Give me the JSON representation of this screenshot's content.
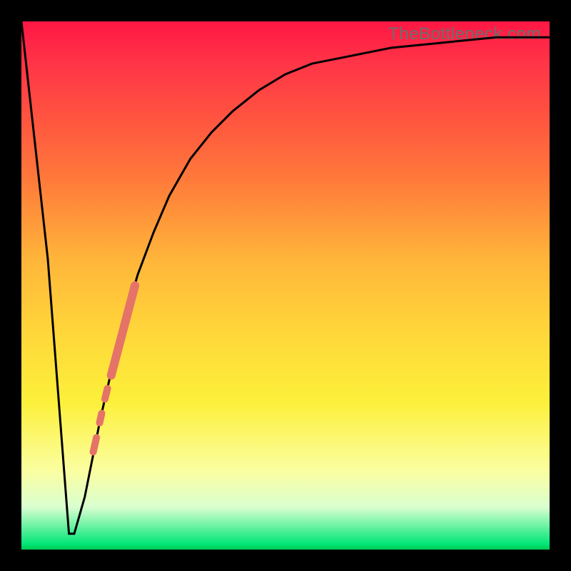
{
  "watermark": "TheBottleneck.com",
  "chart_data": {
    "type": "line",
    "title": "",
    "xlabel": "",
    "ylabel": "",
    "xlim": [
      0,
      100
    ],
    "ylim": [
      0,
      100
    ],
    "grid": false,
    "series": [
      {
        "name": "bottleneck-curve",
        "x": [
          0,
          5,
          9,
          10,
          12,
          15,
          18,
          20,
          22,
          25,
          28,
          32,
          36,
          40,
          45,
          50,
          55,
          60,
          70,
          80,
          90,
          100
        ],
        "y": [
          100,
          55,
          3,
          3,
          10,
          25,
          38,
          45,
          52,
          60,
          67,
          74,
          79,
          83,
          87,
          90,
          92,
          93,
          95,
          96,
          97,
          97
        ]
      }
    ],
    "overlay_segments": [
      {
        "name": "highlight-thick",
        "x0": 17.0,
        "y0": 33.0,
        "x1": 21.5,
        "y1": 50.0,
        "width": 12
      },
      {
        "name": "highlight-dot-1",
        "x0": 15.8,
        "y0": 28.5,
        "x1": 16.3,
        "y1": 30.5,
        "width": 10
      },
      {
        "name": "highlight-dot-2",
        "x0": 14.8,
        "y0": 24.0,
        "x1": 15.2,
        "y1": 25.8,
        "width": 10
      },
      {
        "name": "highlight-dot-3",
        "x0": 13.6,
        "y0": 18.5,
        "x1": 14.2,
        "y1": 21.2,
        "width": 10
      }
    ],
    "colors": {
      "curve": "#000000",
      "highlight": "#e57368",
      "frame": "#000000"
    }
  }
}
